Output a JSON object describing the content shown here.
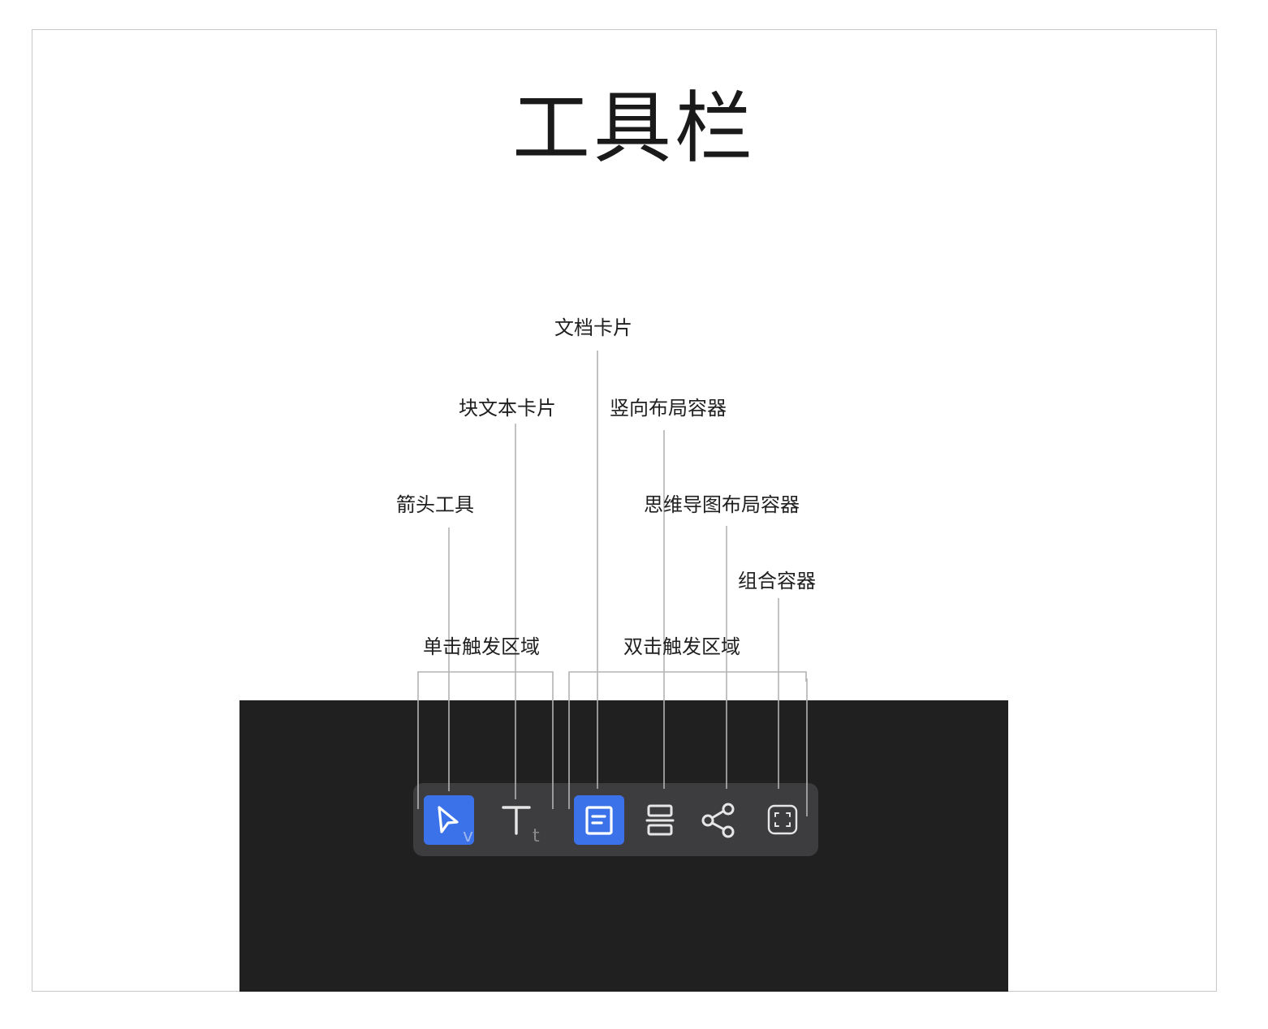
{
  "title": "工具栏",
  "labels": {
    "arrow_tool": "箭头工具",
    "block_text_card": "块文本卡片",
    "doc_card": "文档卡片",
    "vertical_layout": "竖向布局容器",
    "mindmap_layout": "思维导图布局容器",
    "group_container": "组合容器",
    "single_click_area": "单击触发区域",
    "double_click_area": "双击触发区域"
  },
  "toolbar": {
    "tools": [
      {
        "name": "arrow-tool",
        "icon": "cursor-arrow-icon",
        "hotkey": "v",
        "active": true
      },
      {
        "name": "text-tool",
        "icon": "text-t-icon",
        "hotkey": "t",
        "active": false
      },
      {
        "name": "doc-card-tool",
        "icon": "document-icon",
        "active": true
      },
      {
        "name": "vertical-layout-tool",
        "icon": "vertical-layout-icon",
        "active": false
      },
      {
        "name": "mindmap-tool",
        "icon": "share-nodes-icon",
        "active": false
      },
      {
        "name": "group-tool",
        "icon": "focus-frame-icon",
        "active": false
      }
    ]
  },
  "colors": {
    "active_bg": "#3b72e9",
    "toolbar_bg": "#3d3d3f",
    "canvas_bg": "#202020",
    "line": "#b3b3b3"
  }
}
